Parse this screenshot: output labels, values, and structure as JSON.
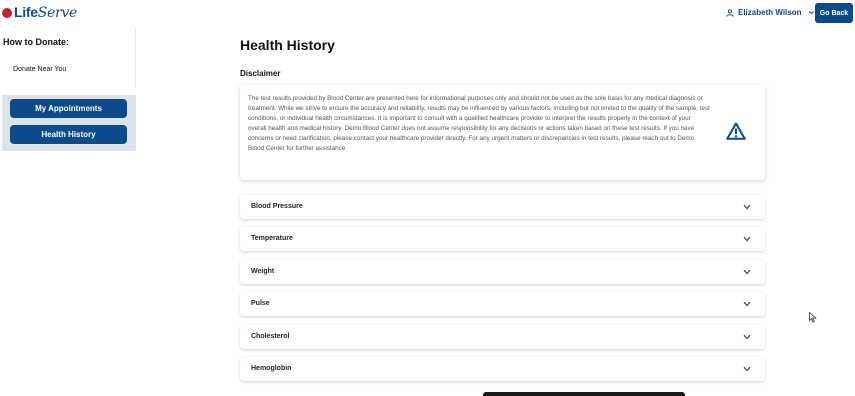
{
  "header": {
    "logo_main": "Life",
    "logo_script": "Serve",
    "user_name": "Elizabeth Wilson",
    "go_back_label": "Go Back"
  },
  "sidebar": {
    "title": "How to Donate:",
    "links": [
      "Donate Near You"
    ],
    "buttons": [
      "My Appointments",
      "Health History"
    ]
  },
  "main": {
    "page_title": "Health History",
    "disclaimer_label": "Disclaimer",
    "disclaimer_text": "The test results provided by Blood Center are presented here for informational purposes only and should not be used as the sole basis for any medical diagnosis or treatment. While we strive to ensure the accuracy and reliability, results may be influenced by various factors, including but not limited to the quality of the sample, test conditions, or individual health circumstances. It is important to consult with a qualified healthcare provider to interpret the results properly in the context of your overall health and medical history. Demo Blood Center does not assume responsibility for any decisions or actions taken based on these test results. If you have concerns or need clarification, please contact your healthcare provider directly. For any urgent matters or discrepancies in test results, please reach out to Demo Blood Center for further assistance.",
    "sections": [
      "Blood Pressure",
      "Temperature",
      "Weight",
      "Pulse",
      "Cholesterol",
      "Hemoglobin"
    ]
  },
  "colors": {
    "brand": "#0d4a8a",
    "logo_drop": "#c8202f",
    "sidebar_panel": "#dbe3ec"
  },
  "icons": {
    "user": "user-icon",
    "chevron": "chevron-down-icon",
    "warning": "warning-triangle-icon"
  }
}
